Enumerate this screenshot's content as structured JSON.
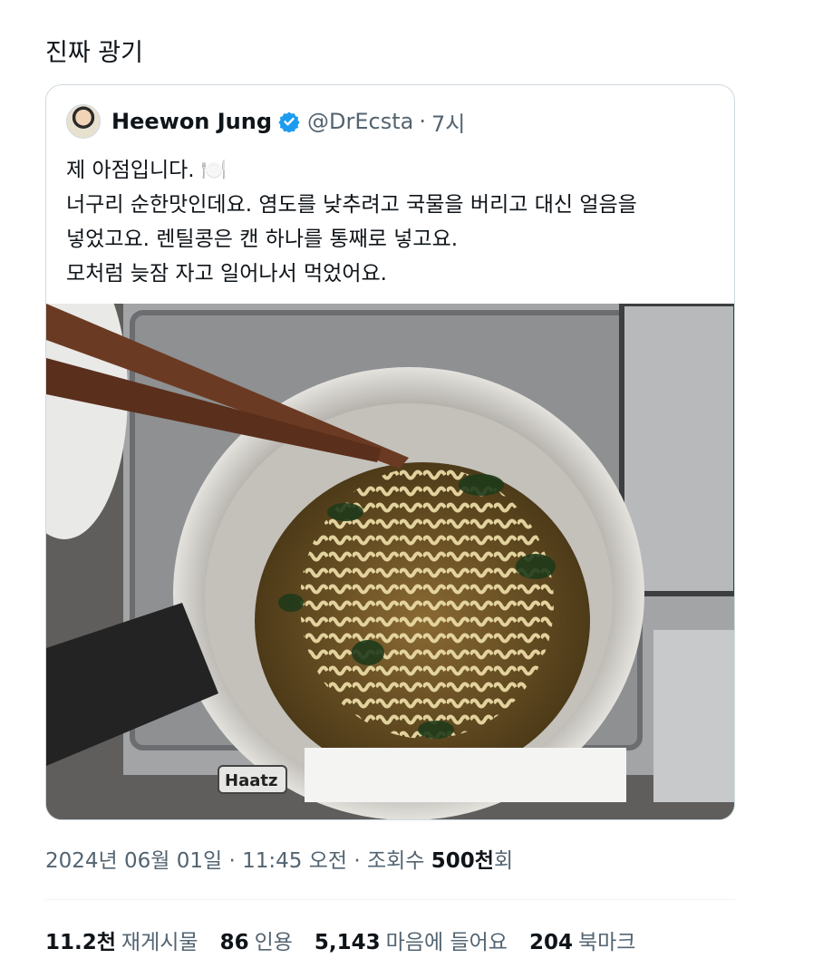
{
  "tweet": {
    "text": "진짜 광기"
  },
  "quoted": {
    "author_name": "Heewon Jung",
    "handle": "@DrEcsta",
    "separator": "·",
    "time": "7시",
    "lines": [
      "제 아점입니다. 🍽️",
      "너구리 순한맛인데요. 염도를 낮추려고 국물을 버리고 대신 얼음을",
      "넣었고요. 렌틸콩은 캔 하나를 통째로 넣고요.",
      "모처럼 늦잠 자고 일어나서 먹었어요."
    ],
    "image_labels": {
      "brand": "Haatz"
    }
  },
  "meta": {
    "date": "2024년 06월 01일",
    "sep1": "·",
    "time": "11:45 오전",
    "sep2": "·",
    "views_label": "조회수",
    "views_num": "500천",
    "views_suffix": "회"
  },
  "stats": [
    {
      "num": "11.2천",
      "label": "재게시물"
    },
    {
      "num": "86",
      "label": "인용"
    },
    {
      "num": "5,143",
      "label": "마음에 들어요"
    },
    {
      "num": "204",
      "label": "북마크"
    }
  ],
  "colors": {
    "verified": "#1d9bf0",
    "secondary_text": "#536471",
    "border": "#cfd9de"
  }
}
